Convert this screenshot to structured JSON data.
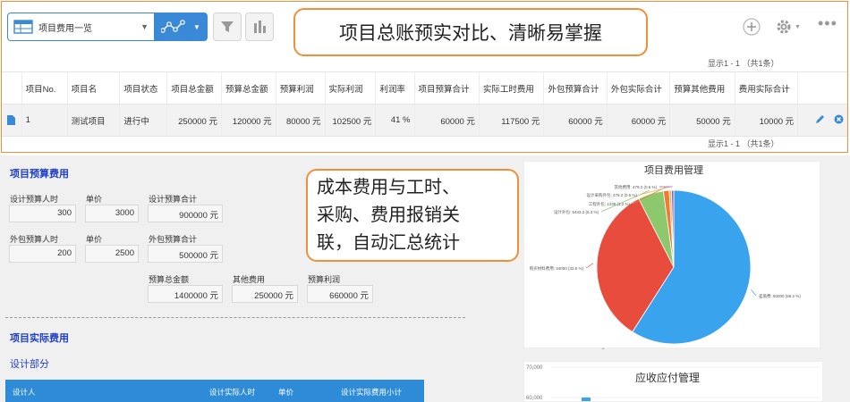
{
  "view_selector": {
    "label": "项目费用一览"
  },
  "callouts": {
    "top": "项目总账预实对比、清晰易掌握",
    "mid_lines": [
      "成本费用与工时、",
      "采购、费用报销关",
      "联，自动汇总统计"
    ]
  },
  "pager": {
    "top": "显示1 - 1 （共1条）",
    "bottom": "显示1 - 1 （共1条）"
  },
  "table": {
    "columns": [
      "项目No.",
      "项目名",
      "项目状态",
      "项目总金额",
      "预算总金额",
      "预算利润",
      "实际利润",
      "利润率",
      "项目预算合计",
      "实际工时费用",
      "外包预算合计",
      "外包实际合计",
      "预算其他费用",
      "费用实际合计"
    ],
    "rows": [
      [
        "1",
        "测试项目",
        "进行中",
        "250000 元",
        "120000 元",
        "80000 元",
        "102500 元",
        "41 %",
        "60000 元",
        "117500 元",
        "60000 元",
        "60000 元",
        "50000 元",
        "10000 元"
      ]
    ]
  },
  "budget_section": {
    "title": "项目预算费用",
    "design_hours_label": "设计预算人时",
    "design_hours_value": "300",
    "design_price_label": "单价",
    "design_price_value": "3000",
    "design_total_label": "设计预算合计",
    "design_total_value": "900000 元",
    "outsource_hours_label": "外包预算人时",
    "outsource_hours_value": "200",
    "outsource_price_label": "单价",
    "outsource_price_value": "2500",
    "outsource_total_label": "外包预算合计",
    "outsource_total_value": "500000 元",
    "budget_total_label": "预算总金额",
    "budget_total_value": "1400000 元",
    "other_cost_label": "其他费用",
    "other_cost_value": "250000 元",
    "budget_profit_label": "预算利润",
    "budget_profit_value": "660000 元"
  },
  "actual_section": {
    "title": "项目实际费用",
    "subtitle": "设计部分",
    "header": [
      "设计人",
      "设计实际人时",
      "单价",
      "设计实际费用小计"
    ]
  },
  "colors": {
    "accent": "#3a89d6",
    "callout_border": "#ef8f3a",
    "section_title": "#1d3fcc"
  },
  "chart_data": [
    {
      "type": "pie",
      "title": "项目费用管理",
      "series": [
        {
          "label": "差旅费: 60000 (59.2 %)",
          "value": 60000,
          "color": "#3aa3ee"
        },
        {
          "label": "购买材料费用: 34000 (33.5 %)",
          "value": 34000,
          "color": "#e84c3d"
        },
        {
          "label": "设计外包: 5443.2 (5.3 %)",
          "value": 5443.2,
          "color": "#8dc86c"
        },
        {
          "label": "工程外包: 1239 (1.2 %)",
          "value": 1239,
          "color": "#f07a36"
        },
        {
          "label": "设计采购外包: 479.2 (0.5 %)",
          "value": 479.2,
          "color": "#f2b14a"
        },
        {
          "label": "其他费用: 479.2 (0.5 %)",
          "value": 479.2,
          "color": "#9b59b6"
        }
      ]
    },
    {
      "type": "bar",
      "title": "应收应付管理",
      "ytick_labels": [
        "70,000",
        "60,000"
      ]
    }
  ]
}
